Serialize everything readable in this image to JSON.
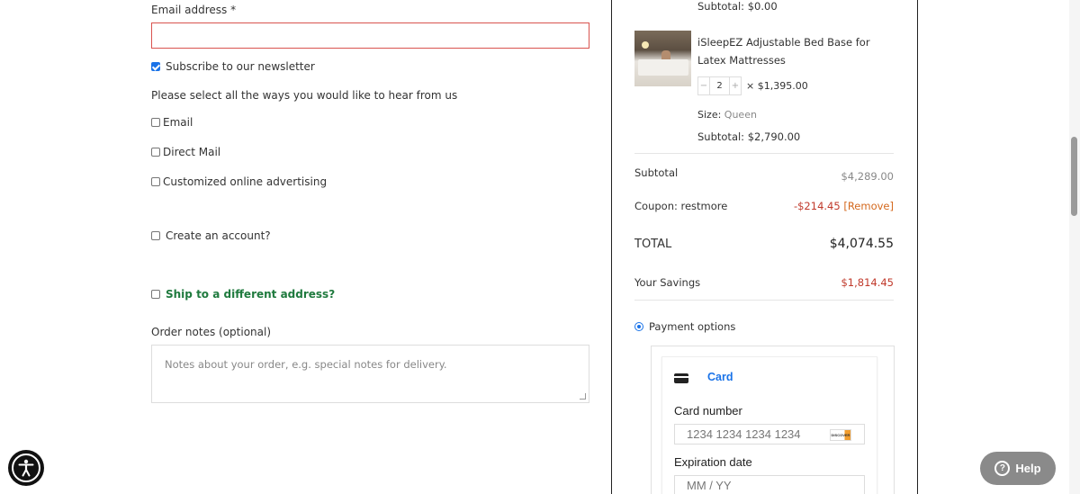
{
  "form": {
    "email_label": "Email address *",
    "email_value": "",
    "newsletter_label": "Subscribe to our newsletter",
    "newsletter_checked": true,
    "hear_prompt": "Please select all the ways you would like to hear from us",
    "options": [
      "Email",
      "Direct Mail",
      "Customized online advertising"
    ],
    "create_account_label": "Create an account?",
    "ship_different_label": "Ship to a different address?",
    "order_notes_label": "Order notes (optional)",
    "order_notes_placeholder": "Notes about your order, e.g. special notes for delivery."
  },
  "order": {
    "prev_subtotal": "Subtotal: $0.00",
    "item": {
      "name_line1": "iSleepEZ Adjustable Bed Base for",
      "name_line2": "Latex Mattresses",
      "qty_minus": "−",
      "qty": "2",
      "qty_plus": "+",
      "price": "× $1,395.00",
      "size_label": "Size:",
      "size_value": "Queen",
      "subtotal": "Subtotal: $2,790.00"
    },
    "subtotal_label": "Subtotal",
    "subtotal_value": "$4,289.00",
    "coupon_label": "Coupon: restmore",
    "coupon_value": "-$214.45",
    "coupon_remove": "[Remove]",
    "total_label": "TOTAL",
    "total_value": "$4,074.55",
    "savings_label": "Your Savings",
    "savings_value": "$1,814.45"
  },
  "payment": {
    "options_label": "Payment options",
    "card_tab": "Card",
    "card_number_label": "Card number",
    "card_number_placeholder": "1234 1234 1234 1234",
    "card_brand": "DISCOVER",
    "expiration_label": "Expiration date",
    "expiration_placeholder": "MM / YY"
  },
  "widgets": {
    "help_label": "Help",
    "help_icon_glyph": "?"
  },
  "colors": {
    "accent": "#1a73e8",
    "ship_link": "#1f7a3e",
    "savings": "#c0392b",
    "coupon": "#d4691e",
    "email_error_border": "#d9534f"
  }
}
